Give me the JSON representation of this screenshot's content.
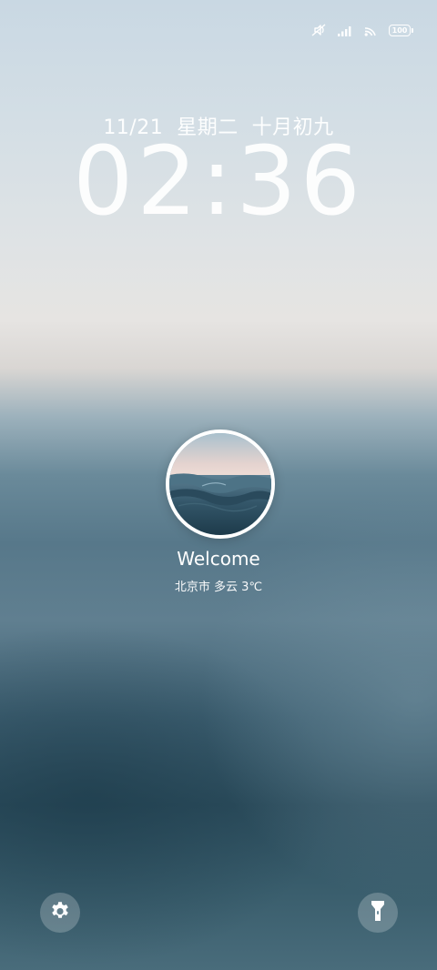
{
  "status_bar": {
    "icons": [
      "mute-icon",
      "signal-icon",
      "wifi-icon",
      "battery-icon"
    ],
    "battery_level": "100"
  },
  "lockscreen": {
    "date": "11/21  星期二  十月初九",
    "time": "02:36"
  },
  "profile": {
    "avatar_icon": "ocean-wave-photo",
    "greeting": "Welcome",
    "weather": "北京市 多云 3℃"
  },
  "shortcuts": {
    "left_icon": "gear-icon",
    "right_icon": "flashlight-icon"
  },
  "colors": {
    "sky_top": "#c9d8e3",
    "sea_mid": "#57788a",
    "sea_dark": "#2c4d5d",
    "button_bg": "rgba(255,255,255,0.22)"
  }
}
